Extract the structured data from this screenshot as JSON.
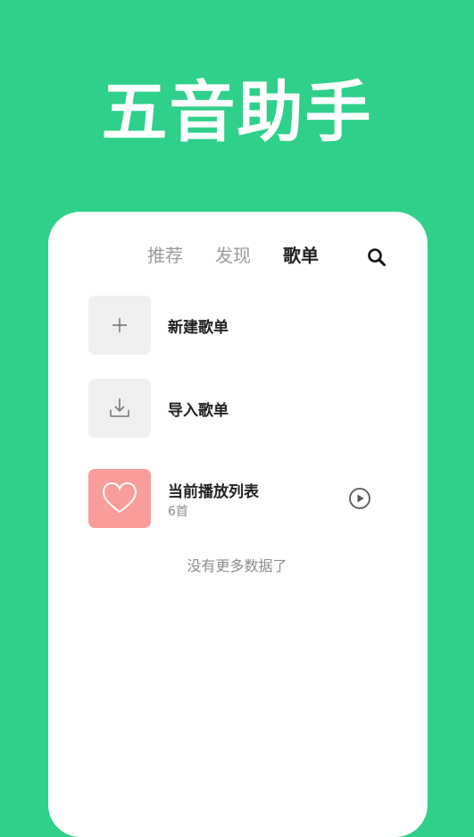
{
  "app": {
    "title": "五音助手"
  },
  "tabs": [
    {
      "label": "推荐",
      "active": false
    },
    {
      "label": "发现",
      "active": false
    },
    {
      "label": "歌单",
      "active": true
    }
  ],
  "icons": {
    "search": "search-icon",
    "add": "plus-icon",
    "import": "download-icon",
    "favorite": "heart-icon",
    "play": "play-circle-icon"
  },
  "playlists": [
    {
      "label": "新建歌单"
    },
    {
      "label": "导入歌单"
    },
    {
      "label": "当前播放列表",
      "count": "6首"
    }
  ],
  "footer": {
    "end_text": "没有更多数据了"
  },
  "colors": {
    "background": "#2fd08a",
    "card": "#ffffff",
    "thumb_gray": "#efefef",
    "thumb_pink": "#f99d9a",
    "text_primary": "#222222",
    "text_secondary": "#8d8d8d"
  }
}
